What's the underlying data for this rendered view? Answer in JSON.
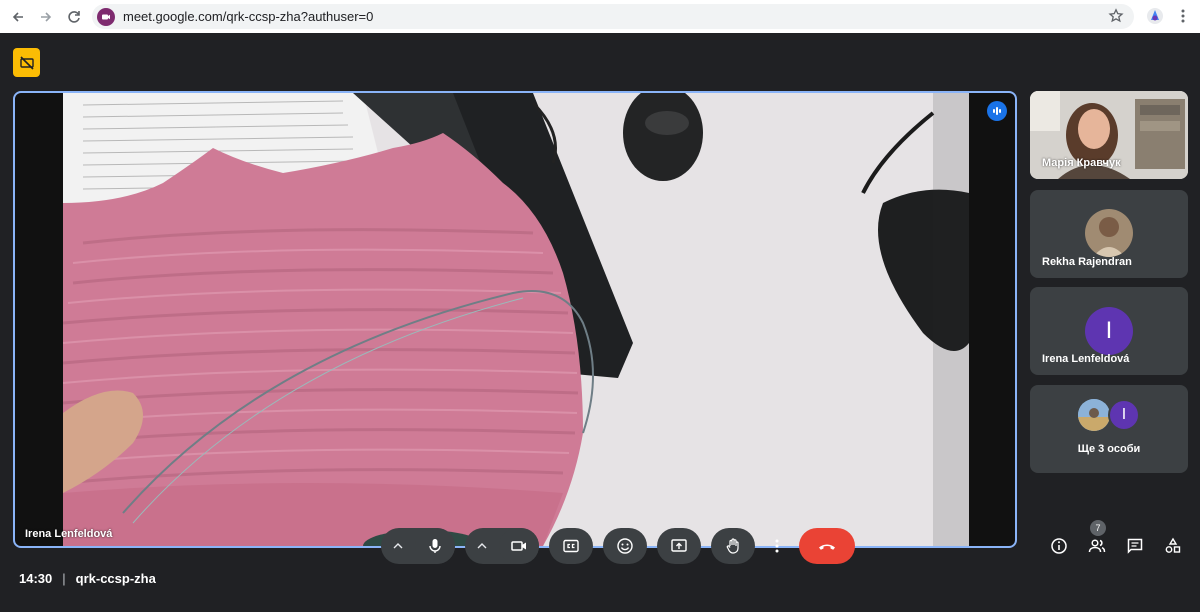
{
  "browser": {
    "url": "meet.google.com/qrk-ccsp-zha?authuser=0"
  },
  "main_video": {
    "participant_name": "Irena Lenfeldová"
  },
  "participants": [
    {
      "name": "Марія Кравчук",
      "type": "video"
    },
    {
      "name": "Rekha Rajendran",
      "type": "photo-avatar"
    },
    {
      "name": "Irena Lenfeldová",
      "type": "letter-avatar",
      "letter": "I"
    },
    {
      "name": "Ще 3 особи",
      "type": "more",
      "letter": "I"
    }
  ],
  "meeting": {
    "time": "14:30",
    "separator": "|",
    "code": "qrk-ccsp-zha"
  },
  "toolbar": {
    "people_count": "7"
  },
  "colors": {
    "accent": "#8ab4f8",
    "end_call": "#ea4335",
    "avatar_purple": "#5e35b1",
    "yellow_badge": "#fbbc04",
    "background": "#202124",
    "tile": "#3c4043"
  }
}
